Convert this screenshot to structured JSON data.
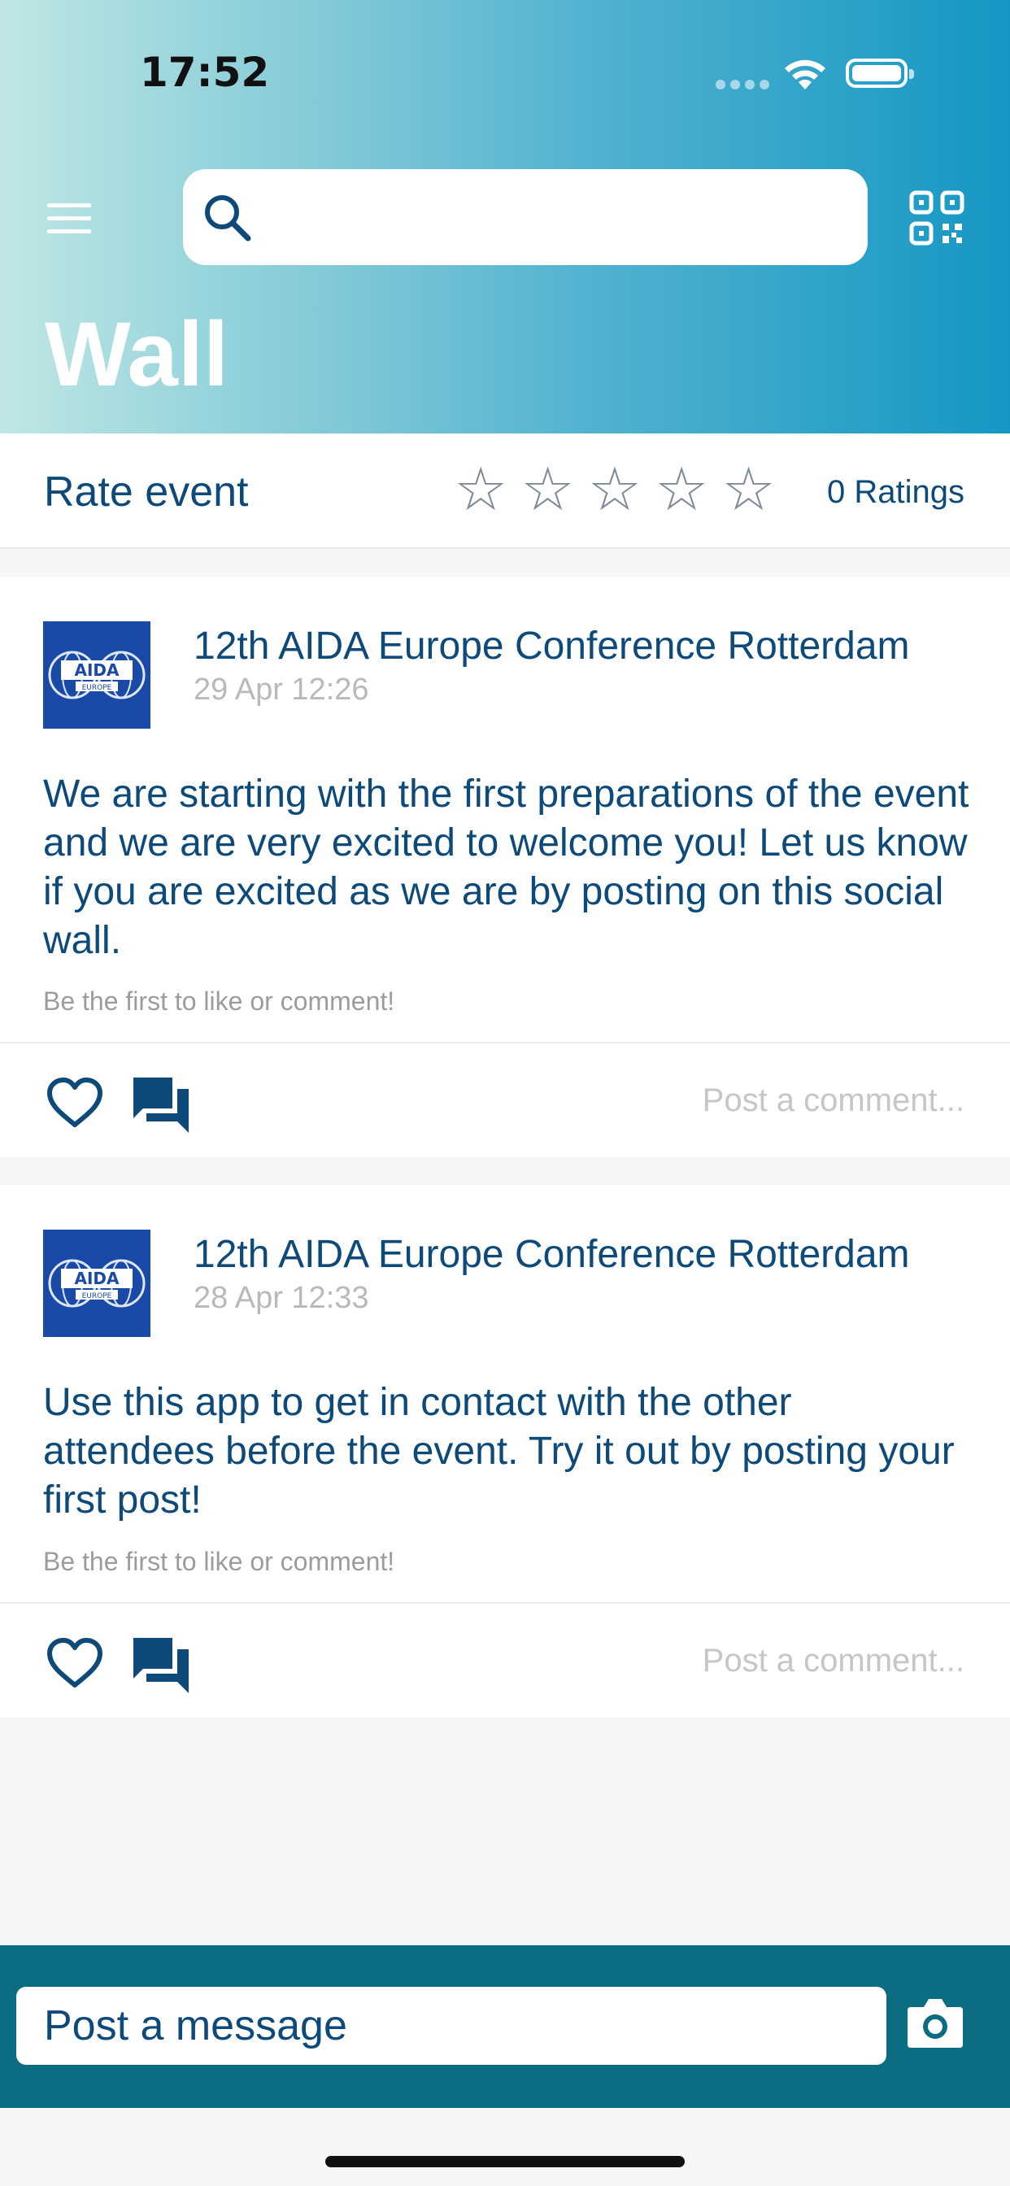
{
  "status_bar": {
    "time": "17:52"
  },
  "header": {
    "title": "Wall",
    "search_placeholder": ""
  },
  "rating": {
    "label": "Rate event",
    "stars": [
      "☆",
      "☆",
      "☆",
      "☆",
      "☆"
    ],
    "score": 0,
    "max": 5,
    "count_text": "0 Ratings"
  },
  "posts": [
    {
      "author": "12th AIDA Europe Conference Rotterdam",
      "date": "29 Apr 12:26",
      "text": "We are starting with the first preparations of the event and we are very excited to welcome you! Let us know if you are excited as we are by posting on this social wall.",
      "engagement": "Be the first to like or comment!",
      "comment_prompt": "Post a comment..."
    },
    {
      "author": "12th AIDA Europe Conference Rotterdam",
      "date": "28 Apr 12:33",
      "text": "Use this app to get in contact with the other attendees before the event. Try it out by posting your first post!",
      "engagement": "Be the first to like or comment!",
      "comment_prompt": "Post a comment..."
    }
  ],
  "avatar_logo": {
    "top": "AIDA",
    "bottom": "EUROPE"
  },
  "composer": {
    "placeholder": "Post a message"
  },
  "icons": {
    "menu": "hamburger-menu-icon",
    "search": "search-icon",
    "qr": "qr-code-icon",
    "like": "heart-icon",
    "comment": "comment-bubbles-icon",
    "camera": "camera-icon"
  },
  "colors": {
    "primary_text": "#0d4a7a",
    "header_gradient_start": "#bfe7e4",
    "header_gradient_end": "#1597c4",
    "composer_bar": "#0b6c82"
  }
}
